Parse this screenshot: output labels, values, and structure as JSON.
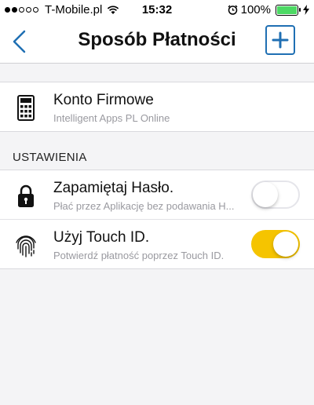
{
  "status_bar": {
    "carrier": "T-Mobile.pl",
    "time": "15:32",
    "battery": "100%",
    "signal_bars_filled": 2,
    "signal_bars_total": 5
  },
  "nav": {
    "title": "Sposób Płatności",
    "back_icon": "chevron-left-icon",
    "add_icon": "plus-icon"
  },
  "account": {
    "title": "Konto Firmowe",
    "subtitle": "Intelligent Apps PL Online",
    "icon": "calculator-icon"
  },
  "settings": {
    "header": "USTAWIENIA",
    "items": [
      {
        "title": "Zapamiętaj Hasło.",
        "subtitle": "Płać przez Aplikację bez podawania H...",
        "icon": "lock-icon",
        "enabled": false
      },
      {
        "title": "Użyj Touch ID.",
        "subtitle": "Potwierdź płatność poprzez Touch ID.",
        "icon": "fingerprint-icon",
        "enabled": true
      }
    ]
  },
  "colors": {
    "accent": "#1f6fb3",
    "toggle_on": "#f5c400",
    "battery": "#4cd964"
  }
}
